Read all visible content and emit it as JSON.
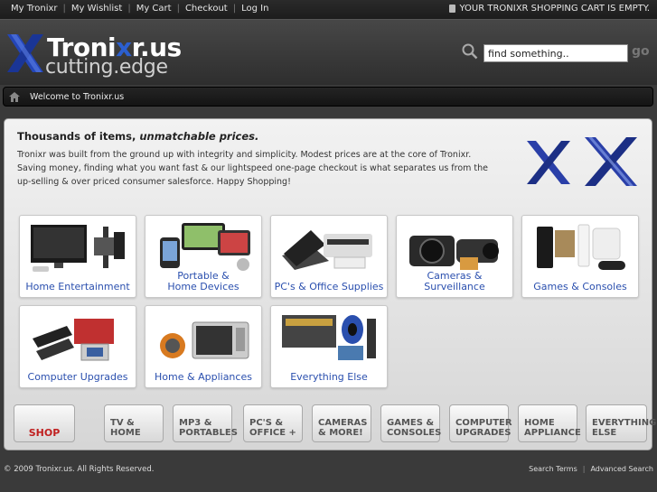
{
  "topnav": {
    "items": [
      "My Tronixr",
      "My Wishlist",
      "My Cart",
      "Checkout",
      "Log In"
    ],
    "cart_message": "YOUR TRONIXR SHOPPING CART IS EMPTY."
  },
  "header": {
    "logo_main_prefix": "Troni",
    "logo_main_highlight": "x",
    "logo_main_suffix": "r.us",
    "logo_tagline": "cutting.edge",
    "search_value": "find something..",
    "go_label": "go"
  },
  "breadcrumb": {
    "text": "Welcome to Tronixr.us"
  },
  "intro": {
    "title_plain": "Thousands of items, ",
    "title_italic": "unmatchable prices.",
    "body": "Tronixr was built from the ground up with integrity and simplicity. Modest prices are at the core of Tronixr. Saving money, finding what you want fast & our lightspeed one-page checkout is what separates us from the up-selling & over priced consumer salesforce. Happy Shopping!"
  },
  "categories": [
    {
      "line1": "Home Entertainment",
      "line2": ""
    },
    {
      "line1": "Portable &",
      "line2": "Home Devices"
    },
    {
      "line1": "PC's & Office Supplies",
      "line2": ""
    },
    {
      "line1": "Cameras & Surveillance",
      "line2": ""
    },
    {
      "line1": "Games & Consoles",
      "line2": ""
    },
    {
      "line1": "Computer Upgrades",
      "line2": ""
    },
    {
      "line1": "Home & Appliances",
      "line2": ""
    },
    {
      "line1": "Everything Else",
      "line2": ""
    }
  ],
  "bottom_nav": [
    {
      "line1": "SHOP",
      "line2": ""
    },
    {
      "line1": "TV & HOME",
      "line2": ""
    },
    {
      "line1": "MP3 &",
      "line2": "PORTABLES"
    },
    {
      "line1": "PC'S &",
      "line2": "OFFICE +"
    },
    {
      "line1": "CAMERAS",
      "line2": "& MORE!"
    },
    {
      "line1": "GAMES &",
      "line2": "CONSOLES"
    },
    {
      "line1": "COMPUTER",
      "line2": "UPGRADES"
    },
    {
      "line1": "HOME",
      "line2": "APPLIANCE"
    },
    {
      "line1": "EVERYTHING",
      "line2": "ELSE"
    }
  ],
  "footer": {
    "copyright": "© 2009 Tronixr.us. All Rights Reserved.",
    "links": [
      "Search Terms",
      "Advanced Search"
    ]
  },
  "colors": {
    "accent_blue": "#2a4fae",
    "shop_red": "#c02020"
  }
}
